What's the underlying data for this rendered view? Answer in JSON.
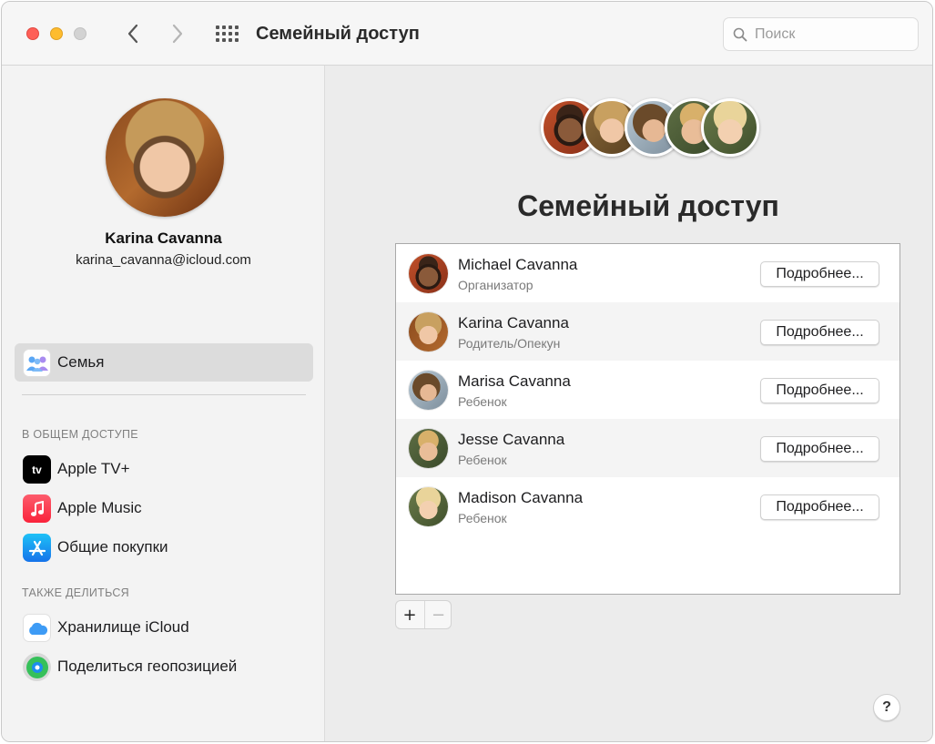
{
  "toolbar": {
    "title": "Семейный доступ",
    "search_placeholder": "Поиск",
    "search_value": ""
  },
  "profile": {
    "name": "Karina Cavanna",
    "email": "karina_cavanna@icloud.com"
  },
  "sidebar": {
    "family_item": {
      "label": "Семья",
      "icon": "family-icon",
      "selected": true
    },
    "shared_header": "В ОБЩЕМ ДОСТУПЕ",
    "shared_items": [
      {
        "label": "Apple TV+",
        "icon": "apple-tv-icon"
      },
      {
        "label": "Apple Music",
        "icon": "music-note-icon"
      },
      {
        "label": "Общие покупки",
        "icon": "app-store-icon"
      }
    ],
    "also_header": "ТАКЖЕ ДЕЛИТЬСЯ",
    "also_items": [
      {
        "label": "Хранилище iCloud",
        "icon": "icloud-icon"
      },
      {
        "label": "Поделиться геопозицией",
        "icon": "find-my-icon"
      }
    ]
  },
  "main": {
    "title": "Семейный доступ",
    "members": [
      {
        "name": "Michael Cavanna",
        "role": "Организатор",
        "button": "Подробнее..."
      },
      {
        "name": "Karina Cavanna",
        "role": "Родитель/Опекун",
        "button": "Подробнее..."
      },
      {
        "name": "Marisa Cavanna",
        "role": "Ребенок",
        "button": "Подробнее..."
      },
      {
        "name": "Jesse Cavanna",
        "role": "Ребенок",
        "button": "Подробнее..."
      },
      {
        "name": "Madison Cavanna",
        "role": "Ребенок",
        "button": "Подробнее..."
      }
    ],
    "add_label": "+",
    "remove_label": "−",
    "help_label": "?"
  },
  "colors": {
    "close": "#fe5f57",
    "minimize": "#febc2e",
    "maximize_disabled": "#d3d3d3",
    "selected_sidebar": "#dcdcdc",
    "music_red": "#fc3c44",
    "app_store_blue": "#1c8cf0",
    "find_my_green": "#34c759"
  }
}
